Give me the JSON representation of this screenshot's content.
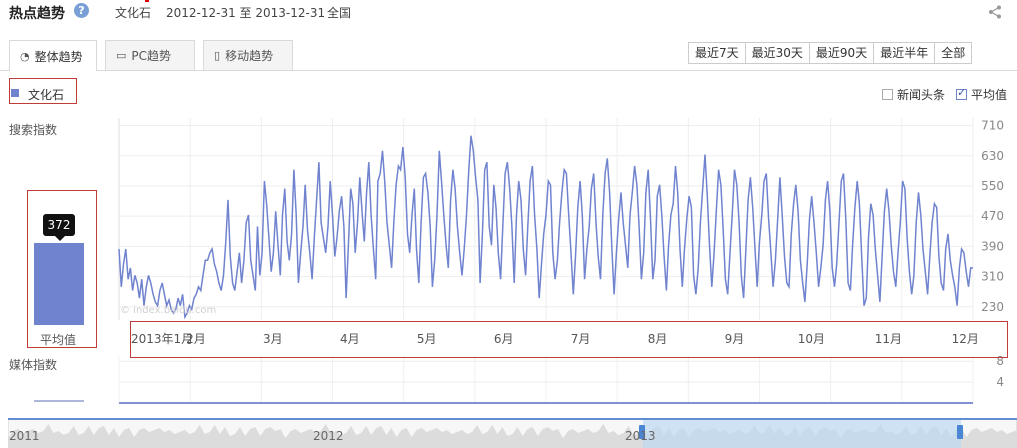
{
  "header": {
    "title": "热点趋势",
    "help_icon": "question-icon",
    "keyword": "文化石",
    "date_range": "2012-12-31 至 2013-12-31",
    "region": "全国",
    "share_icon": "share-icon"
  },
  "tabs": [
    {
      "label": "整体趋势",
      "icon": "pie-icon",
      "active": true
    },
    {
      "label": "PC趋势",
      "icon": "monitor-icon",
      "active": false
    },
    {
      "label": "移动趋势",
      "icon": "mobile-icon",
      "active": false
    }
  ],
  "ranges": [
    "最近7天",
    "最近30天",
    "最近90天",
    "最近半年",
    "全部"
  ],
  "legend": {
    "label": "文化石",
    "color": "#6f83cf"
  },
  "options": {
    "news": {
      "label": "新闻头条",
      "checked": false
    },
    "average": {
      "label": "平均值",
      "checked": true
    }
  },
  "watermark": "© index.baidu.com",
  "chart_data": [
    {
      "type": "line",
      "title": "",
      "ylabel": "搜索指数",
      "ylim": [
        195,
        730
      ],
      "yticks": [
        230,
        310,
        390,
        470,
        550,
        630,
        710
      ],
      "ytick_labels": [
        "230",
        "310",
        "390",
        "470",
        "550",
        "630",
        "710"
      ],
      "x_range": [
        "2012-12-31",
        "2013-12-31"
      ],
      "x_tick_labels": [
        "2013年1月",
        "2月",
        "3月",
        "4月",
        "5月",
        "6月",
        "7月",
        "8月",
        "9月",
        "10月",
        "11月",
        "12月"
      ],
      "series_color": "#6f83cf",
      "grid": true,
      "series": [
        {
          "name": "文化石",
          "y": [
            383,
            283,
            343,
            383,
            303,
            333,
            273,
            313,
            293,
            253,
            303,
            233,
            283,
            313,
            293,
            263,
            243,
            233,
            273,
            293,
            263,
            233,
            248,
            223,
            213,
            223,
            253,
            233,
            263,
            203,
            213,
            233,
            223,
            253,
            263,
            283,
            273,
            313,
            353,
            353,
            373,
            383,
            343,
            323,
            293,
            273,
            313,
            403,
            513,
            363,
            293,
            273,
            323,
            373,
            293,
            353,
            453,
            473,
            353,
            313,
            273,
            443,
            313,
            373,
            563,
            503,
            413,
            323,
            373,
            483,
            393,
            313,
            473,
            543,
            403,
            353,
            423,
            593,
            473,
            293,
            373,
            443,
            553,
            433,
            373,
            303,
            413,
            513,
            613,
            453,
            413,
            373,
            443,
            563,
            473,
            363,
            413,
            483,
            523,
            443,
            253,
            393,
            543,
            503,
            373,
            453,
            573,
            483,
            403,
            533,
            613,
            473,
            383,
            303,
            563,
            583,
            643,
            563,
            453,
            393,
            333,
            453,
            553,
            603,
            593,
            653,
            573,
            423,
            373,
            473,
            543,
            383,
            293,
            453,
            573,
            583,
            533,
            443,
            283,
            353,
            473,
            643,
            563,
            473,
            393,
            333,
            513,
            593,
            543,
            443,
            373,
            313,
            383,
            473,
            593,
            683,
            643,
            573,
            513,
            293,
            423,
            593,
            613,
            443,
            393,
            553,
            493,
            373,
            303,
            443,
            583,
            613,
            543,
            443,
            293,
            473,
            563,
            513,
            383,
            313,
            443,
            563,
            603,
            473,
            383,
            253,
            343,
            423,
            473,
            563,
            553,
            373,
            303,
            353,
            453,
            533,
            593,
            583,
            473,
            373,
            263,
            363,
            493,
            563,
            473,
            303,
            383,
            443,
            543,
            583,
            453,
            363,
            303,
            473,
            583,
            623,
            533,
            383,
            263,
            373,
            463,
            533,
            453,
            393,
            333,
            473,
            533,
            603,
            553,
            443,
            303,
            373,
            533,
            593,
            463,
            303,
            353,
            523,
            553,
            473,
            363,
            273,
            393,
            473,
            503,
            603,
            533,
            383,
            283,
            383,
            463,
            523,
            493,
            313,
            263,
            333,
            453,
            543,
            633,
            523,
            393,
            283,
            373,
            483,
            593,
            553,
            433,
            303,
            263,
            373,
            473,
            593,
            553,
            453,
            313,
            253,
            383,
            513,
            573,
            493,
            383,
            283,
            403,
            473,
            563,
            583,
            463,
            373,
            283,
            353,
            463,
            573,
            473,
            363,
            293,
            283,
            423,
            503,
            553,
            483,
            353,
            293,
            243,
            343,
            463,
            523,
            453,
            373,
            283,
            333,
            393,
            513,
            563,
            483,
            333,
            283,
            343,
            453,
            563,
            583,
            463,
            293,
            273,
            393,
            493,
            563,
            503,
            363,
            233,
            253,
            413,
            503,
            473,
            383,
            313,
            243,
            363,
            483,
            543,
            483,
            393,
            323,
            283,
            373,
            453,
            563,
            543,
            413,
            323,
            263,
            313,
            453,
            533,
            473,
            383,
            323,
            263,
            363,
            453,
            503,
            493,
            363,
            293,
            273,
            383,
            423,
            353,
            313,
            283,
            233,
            333,
            383,
            373,
            323,
            283,
            333,
            333
          ]
        }
      ]
    },
    {
      "type": "line",
      "title": "",
      "ylabel": "媒体指数",
      "ylim": [
        0,
        9
      ],
      "yticks": [
        4,
        8
      ],
      "ytick_labels": [
        "4",
        "8"
      ],
      "series_color": "#6f83cf",
      "series": [
        {
          "name": "文化石",
          "y": [
            0,
            0,
            0,
            0,
            0,
            0,
            0,
            0,
            0,
            0,
            0,
            0,
            0,
            0,
            0,
            0,
            0,
            0,
            0,
            0,
            0,
            0,
            0,
            0,
            0,
            0,
            0,
            0,
            0,
            0,
            0,
            0,
            0,
            0,
            0,
            0,
            0,
            0,
            0,
            0,
            0,
            0,
            0,
            0,
            0,
            0,
            0,
            0,
            0,
            0,
            0,
            0,
            0,
            0,
            0,
            0,
            0,
            0,
            0,
            0,
            0,
            0,
            0,
            0,
            0,
            0,
            0,
            0,
            0,
            0,
            0,
            0,
            0,
            0,
            0,
            0,
            0,
            0,
            0,
            0,
            0,
            0,
            0,
            0,
            0,
            0,
            0,
            0,
            0,
            0,
            0,
            0,
            0,
            0,
            0,
            0,
            0,
            0,
            0,
            0,
            0,
            0,
            0,
            0,
            0,
            0,
            0,
            0,
            0,
            0,
            0,
            0,
            0,
            0,
            0,
            0,
            0,
            0,
            0,
            0,
            0,
            0,
            0,
            0,
            0,
            0,
            0,
            0,
            0,
            0,
            0,
            0,
            0,
            0,
            0,
            0,
            0,
            0,
            0,
            0,
            0,
            0,
            0,
            0,
            0,
            0,
            0,
            0,
            0,
            0,
            0,
            0,
            0,
            0,
            0,
            0,
            0,
            0,
            0,
            0,
            0,
            0,
            0,
            0,
            0,
            0,
            0,
            0,
            0,
            0,
            0,
            0,
            0,
            0,
            0,
            0,
            0,
            0,
            0,
            0,
            0,
            0,
            0,
            0,
            0,
            0,
            0,
            0,
            0,
            0,
            0,
            0,
            0,
            0,
            0,
            0,
            0,
            0,
            0,
            0,
            0,
            0,
            0,
            0,
            0,
            0,
            0,
            0,
            0,
            0,
            0,
            0,
            0,
            0,
            0,
            0,
            0,
            0,
            0,
            0,
            0,
            0,
            0,
            0,
            0,
            0,
            0,
            0,
            0,
            0,
            0,
            0,
            0,
            0,
            0,
            0,
            0,
            0,
            0,
            0,
            0,
            0,
            0,
            0,
            0,
            0,
            0,
            0,
            0,
            0,
            0,
            0,
            0,
            0,
            0,
            0,
            0,
            0,
            0,
            0,
            0,
            0,
            0,
            0,
            0,
            0,
            0,
            0,
            0,
            0,
            0,
            0,
            0,
            0,
            0,
            0,
            0,
            0,
            0,
            0,
            0,
            0,
            0,
            0,
            0,
            0,
            0,
            0,
            0,
            0,
            0,
            0,
            0,
            0,
            0,
            0,
            0,
            0,
            0,
            0,
            0,
            0,
            0,
            0,
            0,
            0,
            0,
            0,
            0,
            0,
            0,
            0,
            0,
            0,
            0,
            0,
            0,
            0,
            0,
            0,
            0,
            0,
            0,
            0,
            0,
            0,
            0,
            0,
            0,
            0,
            0,
            0,
            0,
            0,
            0,
            0,
            0,
            0,
            0,
            0,
            0,
            0,
            0,
            0,
            0,
            0,
            0,
            0,
            0,
            0,
            0,
            0,
            0,
            0,
            0,
            0,
            0,
            0,
            0,
            0,
            0,
            0,
            0,
            0,
            0,
            0,
            0,
            0,
            0,
            0,
            0,
            0,
            0,
            0,
            0,
            0,
            0,
            0,
            0,
            0,
            0,
            0
          ]
        }
      ]
    },
    {
      "type": "bar",
      "title": "",
      "categories": [
        "平均值"
      ],
      "values": [
        372
      ],
      "data_labels": [
        "372"
      ]
    }
  ],
  "navigator": {
    "year_labels": [
      "2011",
      "2012",
      "2013"
    ]
  }
}
